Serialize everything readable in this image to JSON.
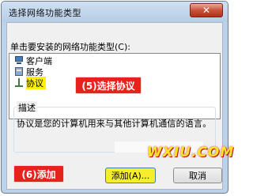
{
  "window": {
    "title": "选择网络功能类型",
    "close_glyph": "✕"
  },
  "dialog": {
    "instruction": "单击要安装的网络功能类型(C):",
    "list_items": [
      {
        "label": "客户端",
        "icon": "network-client-icon"
      },
      {
        "label": "服务",
        "icon": "network-service-icon"
      },
      {
        "label": "协议",
        "icon": "network-protocol-icon",
        "selected": true
      }
    ],
    "description_label": "描述",
    "description_text": "协议是您的计算机用来与其他计算机通信的语言。",
    "add_button": "添加(A)...",
    "cancel_button": "取消"
  },
  "annotations": {
    "step5": "(5)选择协议",
    "step6": "(6)添加",
    "color": "#e5231c",
    "highlight_color": "#fff200"
  },
  "watermark": "WXIU.COM"
}
